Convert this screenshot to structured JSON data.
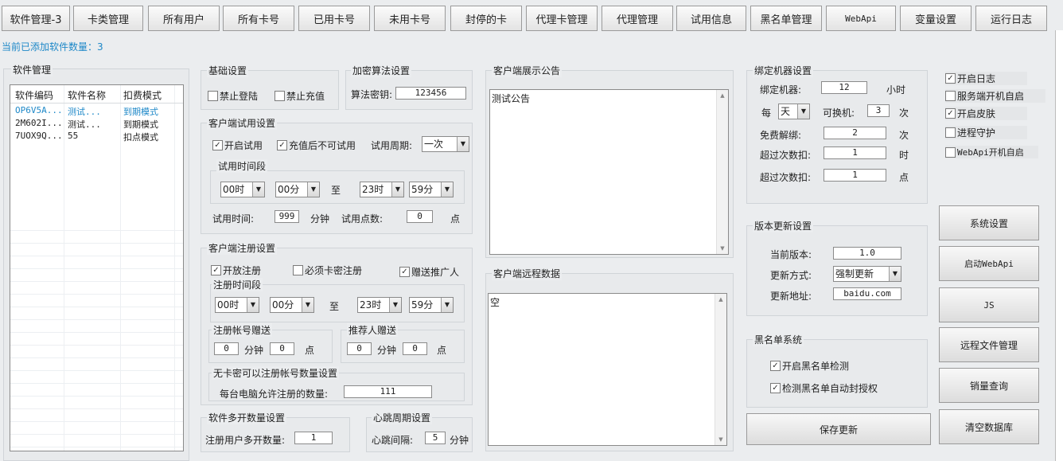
{
  "tabs": [
    "软件管理-3",
    "卡类管理",
    "所有用户",
    "所有卡号",
    "已用卡号",
    "未用卡号",
    "封停的卡",
    "代理卡管理",
    "代理管理",
    "试用信息",
    "黑名单管理",
    "WebApi",
    "变量设置",
    "运行日志"
  ],
  "status_text": "当前已添加软件数量：3",
  "software": {
    "title": "软件管理",
    "columns": [
      "软件编码",
      "软件名称",
      "扣费模式"
    ],
    "rows": [
      {
        "code": "OP6V5A...",
        "name": "测试...",
        "mode": "到期模式",
        "selected": true
      },
      {
        "code": "2M602I...",
        "name": "测试...",
        "mode": "到期模式",
        "selected": false
      },
      {
        "code": "7UOX9Q...",
        "name": "55",
        "mode": "扣点模式",
        "selected": false
      }
    ]
  },
  "basic": {
    "title": "基础设置",
    "forbid_login": "禁止登陆",
    "forbid_recharge": "禁止充值"
  },
  "encrypt": {
    "title": "加密算法设置",
    "key_label": "算法密钥:",
    "key_value": "123456"
  },
  "trial": {
    "title": "客户端试用设置",
    "enable": "开启试用",
    "no_trial_after_recharge": "充值后不可试用",
    "period_label": "试用周期:",
    "period_value": "一次",
    "timespan_title": "试用时间段",
    "from_hour": "00时",
    "from_min": "00分",
    "to_label": "至",
    "to_hour": "23时",
    "to_min": "59分",
    "time_label": "试用时间:",
    "time_value": "999",
    "time_unit": "分钟",
    "points_label": "试用点数:",
    "points_value": "0",
    "points_unit": "点"
  },
  "register": {
    "title": "客户端注册设置",
    "open": "开放注册",
    "require_card": "必须卡密注册",
    "gift_promoter": "赠送推广人",
    "timespan_title": "注册时间段",
    "from_hour": "00时",
    "from_min": "00分",
    "to_label": "至",
    "to_hour": "23时",
    "to_min": "59分",
    "account_gift_title": "注册帐号赠送",
    "account_gift_min": "0",
    "account_gift_min_unit": "分钟",
    "account_gift_pts": "0",
    "account_gift_pts_unit": "点",
    "referrer_gift_title": "推荐人赠送",
    "referrer_gift_min": "0",
    "referrer_gift_min_unit": "分钟",
    "referrer_gift_pts": "0",
    "referrer_gift_pts_unit": "点",
    "nocard_title": "无卡密可以注册帐号数量设置",
    "nocard_label": "每台电脑允许注册的数量:",
    "nocard_value": "111"
  },
  "multi": {
    "title": "软件多开数量设置",
    "label": "注册用户多开数量:",
    "value": "1"
  },
  "heartbeat": {
    "title": "心跳周期设置",
    "label": "心跳间隔:",
    "value": "5",
    "unit": "分钟"
  },
  "notice": {
    "title": "客户端展示公告",
    "content": "测试公告"
  },
  "remote": {
    "title": "客户端远程数据",
    "content": "空"
  },
  "bind": {
    "title": "绑定机器设置",
    "bind_label": "绑定机器:",
    "bind_value": "12",
    "bind_unit": "小时",
    "every_label": "每",
    "every_value": "天",
    "change_label": "可换机:",
    "change_value": "3",
    "change_unit": "次",
    "free_label": "免费解绑:",
    "free_value": "2",
    "free_unit": "次",
    "over1_label": "超过次数扣:",
    "over1_value": "1",
    "over1_unit": "时",
    "over2_label": "超过次数扣:",
    "over2_value": "1",
    "over2_unit": "点"
  },
  "version": {
    "title": "版本更新设置",
    "cur_label": "当前版本:",
    "cur_value": "1.0",
    "mode_label": "更新方式:",
    "mode_value": "强制更新",
    "url_label": "更新地址:",
    "url_value": "baidu.com"
  },
  "blacklist": {
    "title": "黑名单系统",
    "enable": "开启黑名单检测",
    "auto_ban": "检测黑名单自动封授权"
  },
  "save_button": "保存更新",
  "options": [
    {
      "label": "开启日志",
      "checked": true
    },
    {
      "label": "服务端开机自启",
      "checked": false
    },
    {
      "label": "开启皮肤",
      "checked": true
    },
    {
      "label": "进程守护",
      "checked": false
    },
    {
      "label": "WebApi开机自启",
      "checked": false
    }
  ],
  "side_buttons": [
    "系统设置",
    "启动WebApi",
    "JS",
    "远程文件管理",
    "销量查询",
    "清空数据库"
  ],
  "colors": {
    "accent": "#1e88c8",
    "selected_row": "#1e88c8"
  }
}
